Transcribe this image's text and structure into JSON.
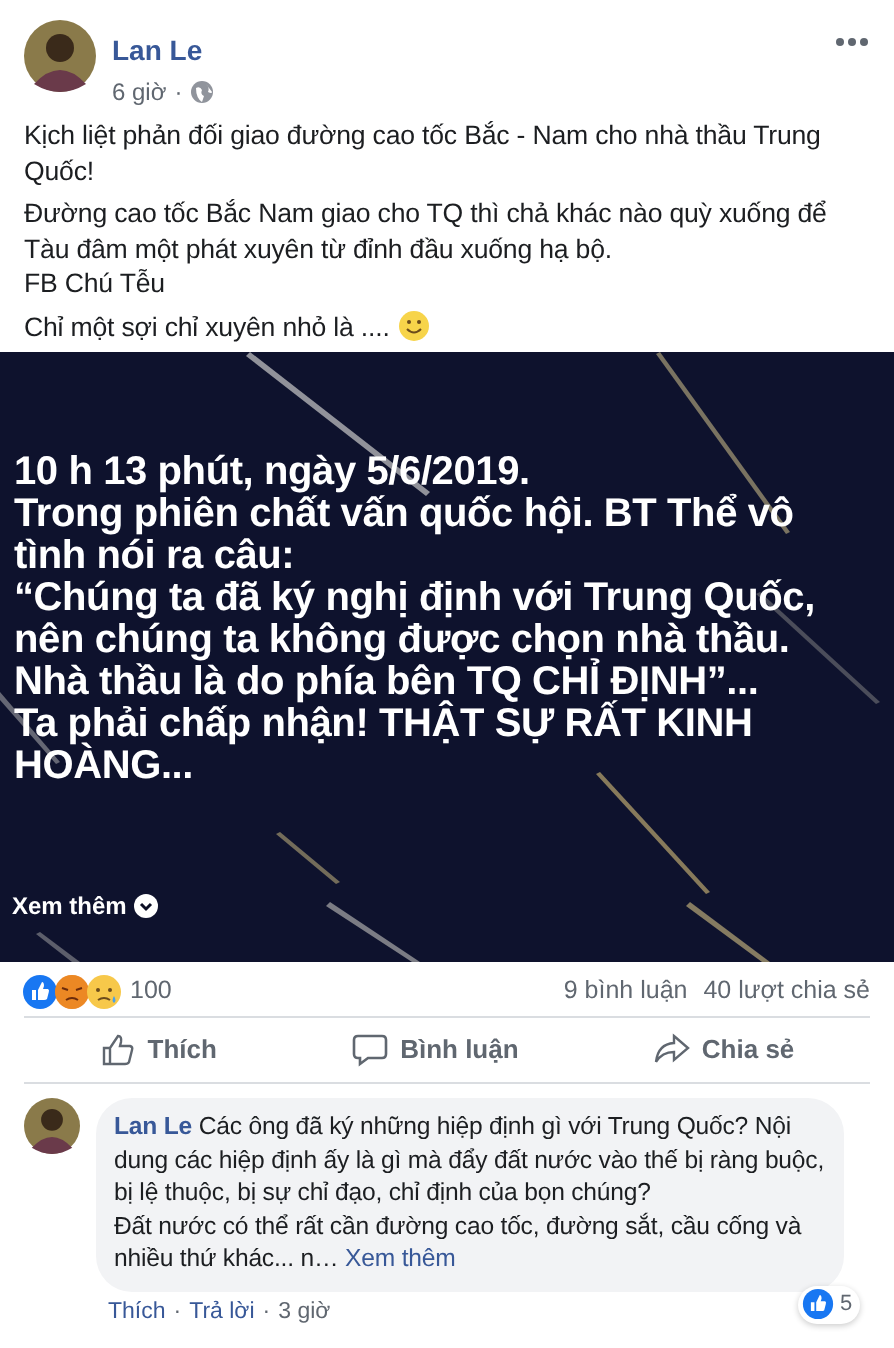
{
  "post": {
    "author": "Lan Le",
    "time": "6 giờ",
    "separator": "·",
    "paragraphs": [
      [
        "Kịch liệt phản đối giao đường cao tốc Bắc - Nam cho nhà thầu Trung Quốc!"
      ],
      [
        "Đường cao tốc Bắc Nam giao cho TQ thì chả khác nào quỳ xuống để Tàu đâm một phát xuyên từ đỉnh đầu xuống hạ bộ.",
        "FB Chú Tễu"
      ],
      [
        "Chỉ một sợi chỉ xuyên nhỏ là ...."
      ]
    ]
  },
  "image": {
    "lines": [
      "10 h 13 phút, ngày 5/6/2019.",
      "Trong phiên chất vấn quốc hội. BT Thể vô",
      "tình nói ra câu:",
      "“Chúng ta đã ký nghị định với Trung Quốc,",
      "nên chúng ta không được chọn nhà thầu.",
      "Nhà thầu là do phía bên TQ CHỈ ĐỊNH”...",
      "Ta phải chấp nhận! THẬT SỰ RẤT KINH",
      "HOÀNG..."
    ],
    "see_more": "Xem thêm"
  },
  "stats": {
    "reactions": [
      {
        "kind": "like"
      },
      {
        "kind": "angry"
      },
      {
        "kind": "sad"
      }
    ],
    "reaction_count": "100",
    "comments": "9 bình luận",
    "shares": "40 lượt chia sẻ"
  },
  "actions": [
    {
      "kind": "like",
      "label": "Thích"
    },
    {
      "kind": "comment",
      "label": "Bình luận"
    },
    {
      "kind": "share",
      "label": "Chia sẻ"
    }
  ],
  "comment": {
    "author": "Lan Le",
    "lines": [
      "Các ông đã ký những hiệp định gì với Trung Quốc? Nội dung các hiệp định ấy là gì mà đẩy đất nước vào thế bị ràng buộc, bị lệ thuộc, bị sự chỉ đạo, chỉ định của bọn chúng?",
      "Đất nước có thể rất cần đường cao tốc, đường sắt, cầu cống và nhiều thứ khác... n…"
    ],
    "see_more": "Xem thêm",
    "reaction_count": "5",
    "like": "Thích",
    "reply": "Trả lời",
    "time": "3 giờ",
    "separator": "·"
  }
}
